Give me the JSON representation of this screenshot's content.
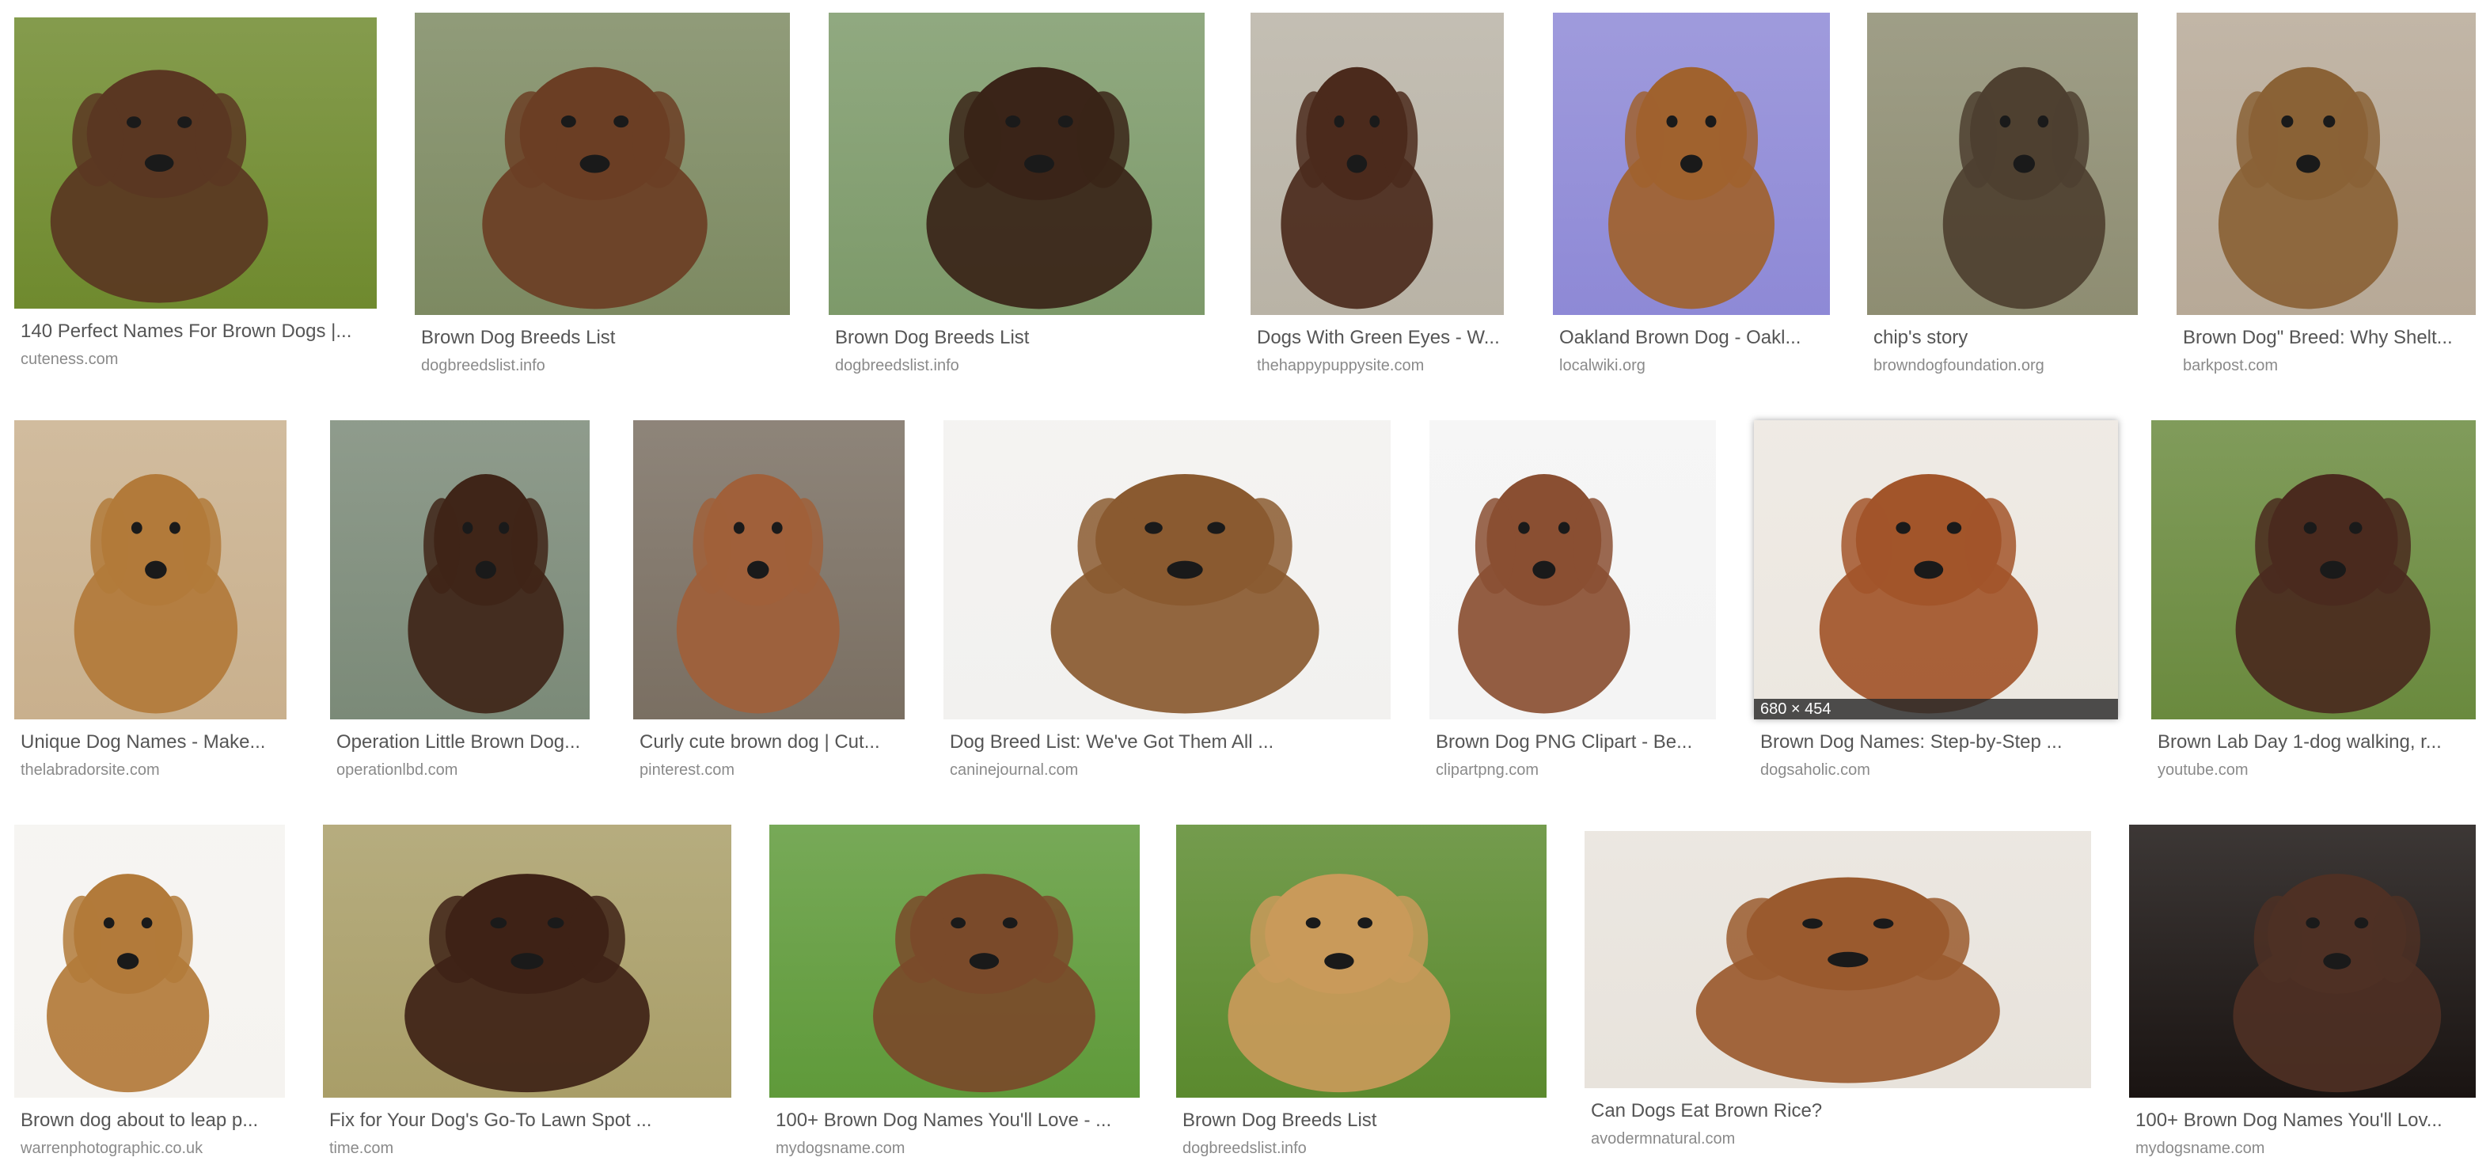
{
  "results": [
    {
      "title": "140 Perfect Names For Brown Dogs |...",
      "source": "cuteness.com",
      "bg": "#6f8a2e",
      "dog": "#5a3722"
    },
    {
      "title": "Brown Dog Breeds List",
      "source": "dogbreedslist.info",
      "bg": "#7d8a62",
      "dog": "#6b3e24"
    },
    {
      "title": "Brown Dog Breeds List",
      "source": "dogbreedslist.info",
      "bg": "#7d9a6a",
      "dog": "#3a2418"
    },
    {
      "title": "Dogs With Green Eyes - W...",
      "source": "thehappypuppysite.com",
      "bg": "#b9b3a6",
      "dog": "#4b2a1c"
    },
    {
      "title": "Oakland Brown Dog - Oakl...",
      "source": "localwiki.org",
      "bg": "#8e89d6",
      "dog": "#a0622e"
    },
    {
      "title": "chip's story",
      "source": "browndogfoundation.org",
      "bg": "#8e8d72",
      "dog": "#4e4030"
    },
    {
      "title": "Brown Dog\" Breed: Why Shelt...",
      "source": "barkpost.com",
      "bg": "#b7a997",
      "dog": "#8a6236"
    },
    {
      "title": "Unique Dog Names - Make...",
      "source": "thelabradorsite.com",
      "bg": "#c9b08d",
      "dog": "#b27a3a"
    },
    {
      "title": "Operation Little Brown Dog...",
      "source": "operationlbd.com",
      "bg": "#7b8a78",
      "dog": "#3f2518"
    },
    {
      "title": "Curly cute brown dog | Cut...",
      "source": "pinterest.com",
      "bg": "#7a6f62",
      "dog": "#a0603a"
    },
    {
      "title": "Dog Breed List: We've Got Them All ...",
      "source": "caninejournal.com",
      "bg": "#f2f1ef",
      "dog": "#8a5a30"
    },
    {
      "title": "Brown Dog PNG Clipart - Be...",
      "source": "clipartpng.com",
      "bg": "#f4f4f4",
      "dog": "#8a4f32"
    },
    {
      "title": "Brown Dog Names: Step-by-Step ...",
      "source": "dogsaholic.com",
      "bg": "#ece7e0",
      "dog": "#a2552a",
      "dims": "680 × 454"
    },
    {
      "title": "Brown Lab Day 1-dog walking, r...",
      "source": "youtube.com",
      "bg": "#6a8a3e",
      "dog": "#4a2a1e"
    },
    {
      "title": "Brown dog about to leap p...",
      "source": "warrenphotographic.co.uk",
      "bg": "#f5f3f0",
      "dog": "#b27a3a"
    },
    {
      "title": "Fix for Your Dog's Go-To Lawn Spot ...",
      "source": "time.com",
      "bg": "#a99e68",
      "dog": "#3e2216"
    },
    {
      "title": "100+ Brown Dog Names You'll Love - ...",
      "source": "mydogsname.com",
      "bg": "#5f9a3a",
      "dog": "#7a4a2a"
    },
    {
      "title": "Brown Dog Breeds List",
      "source": "dogbreedslist.info",
      "bg": "#5b8a2e",
      "dog": "#c99a5a"
    },
    {
      "title": "Can Dogs Eat Brown Rice?",
      "source": "avodermnatural.com",
      "bg": "#e8e3dc",
      "dog": "#9a5a2e"
    },
    {
      "title": "100+ Brown Dog Names You'll Lov...",
      "source": "mydogsname.com",
      "bg": "#1a1412",
      "dog": "#4e3024"
    }
  ]
}
